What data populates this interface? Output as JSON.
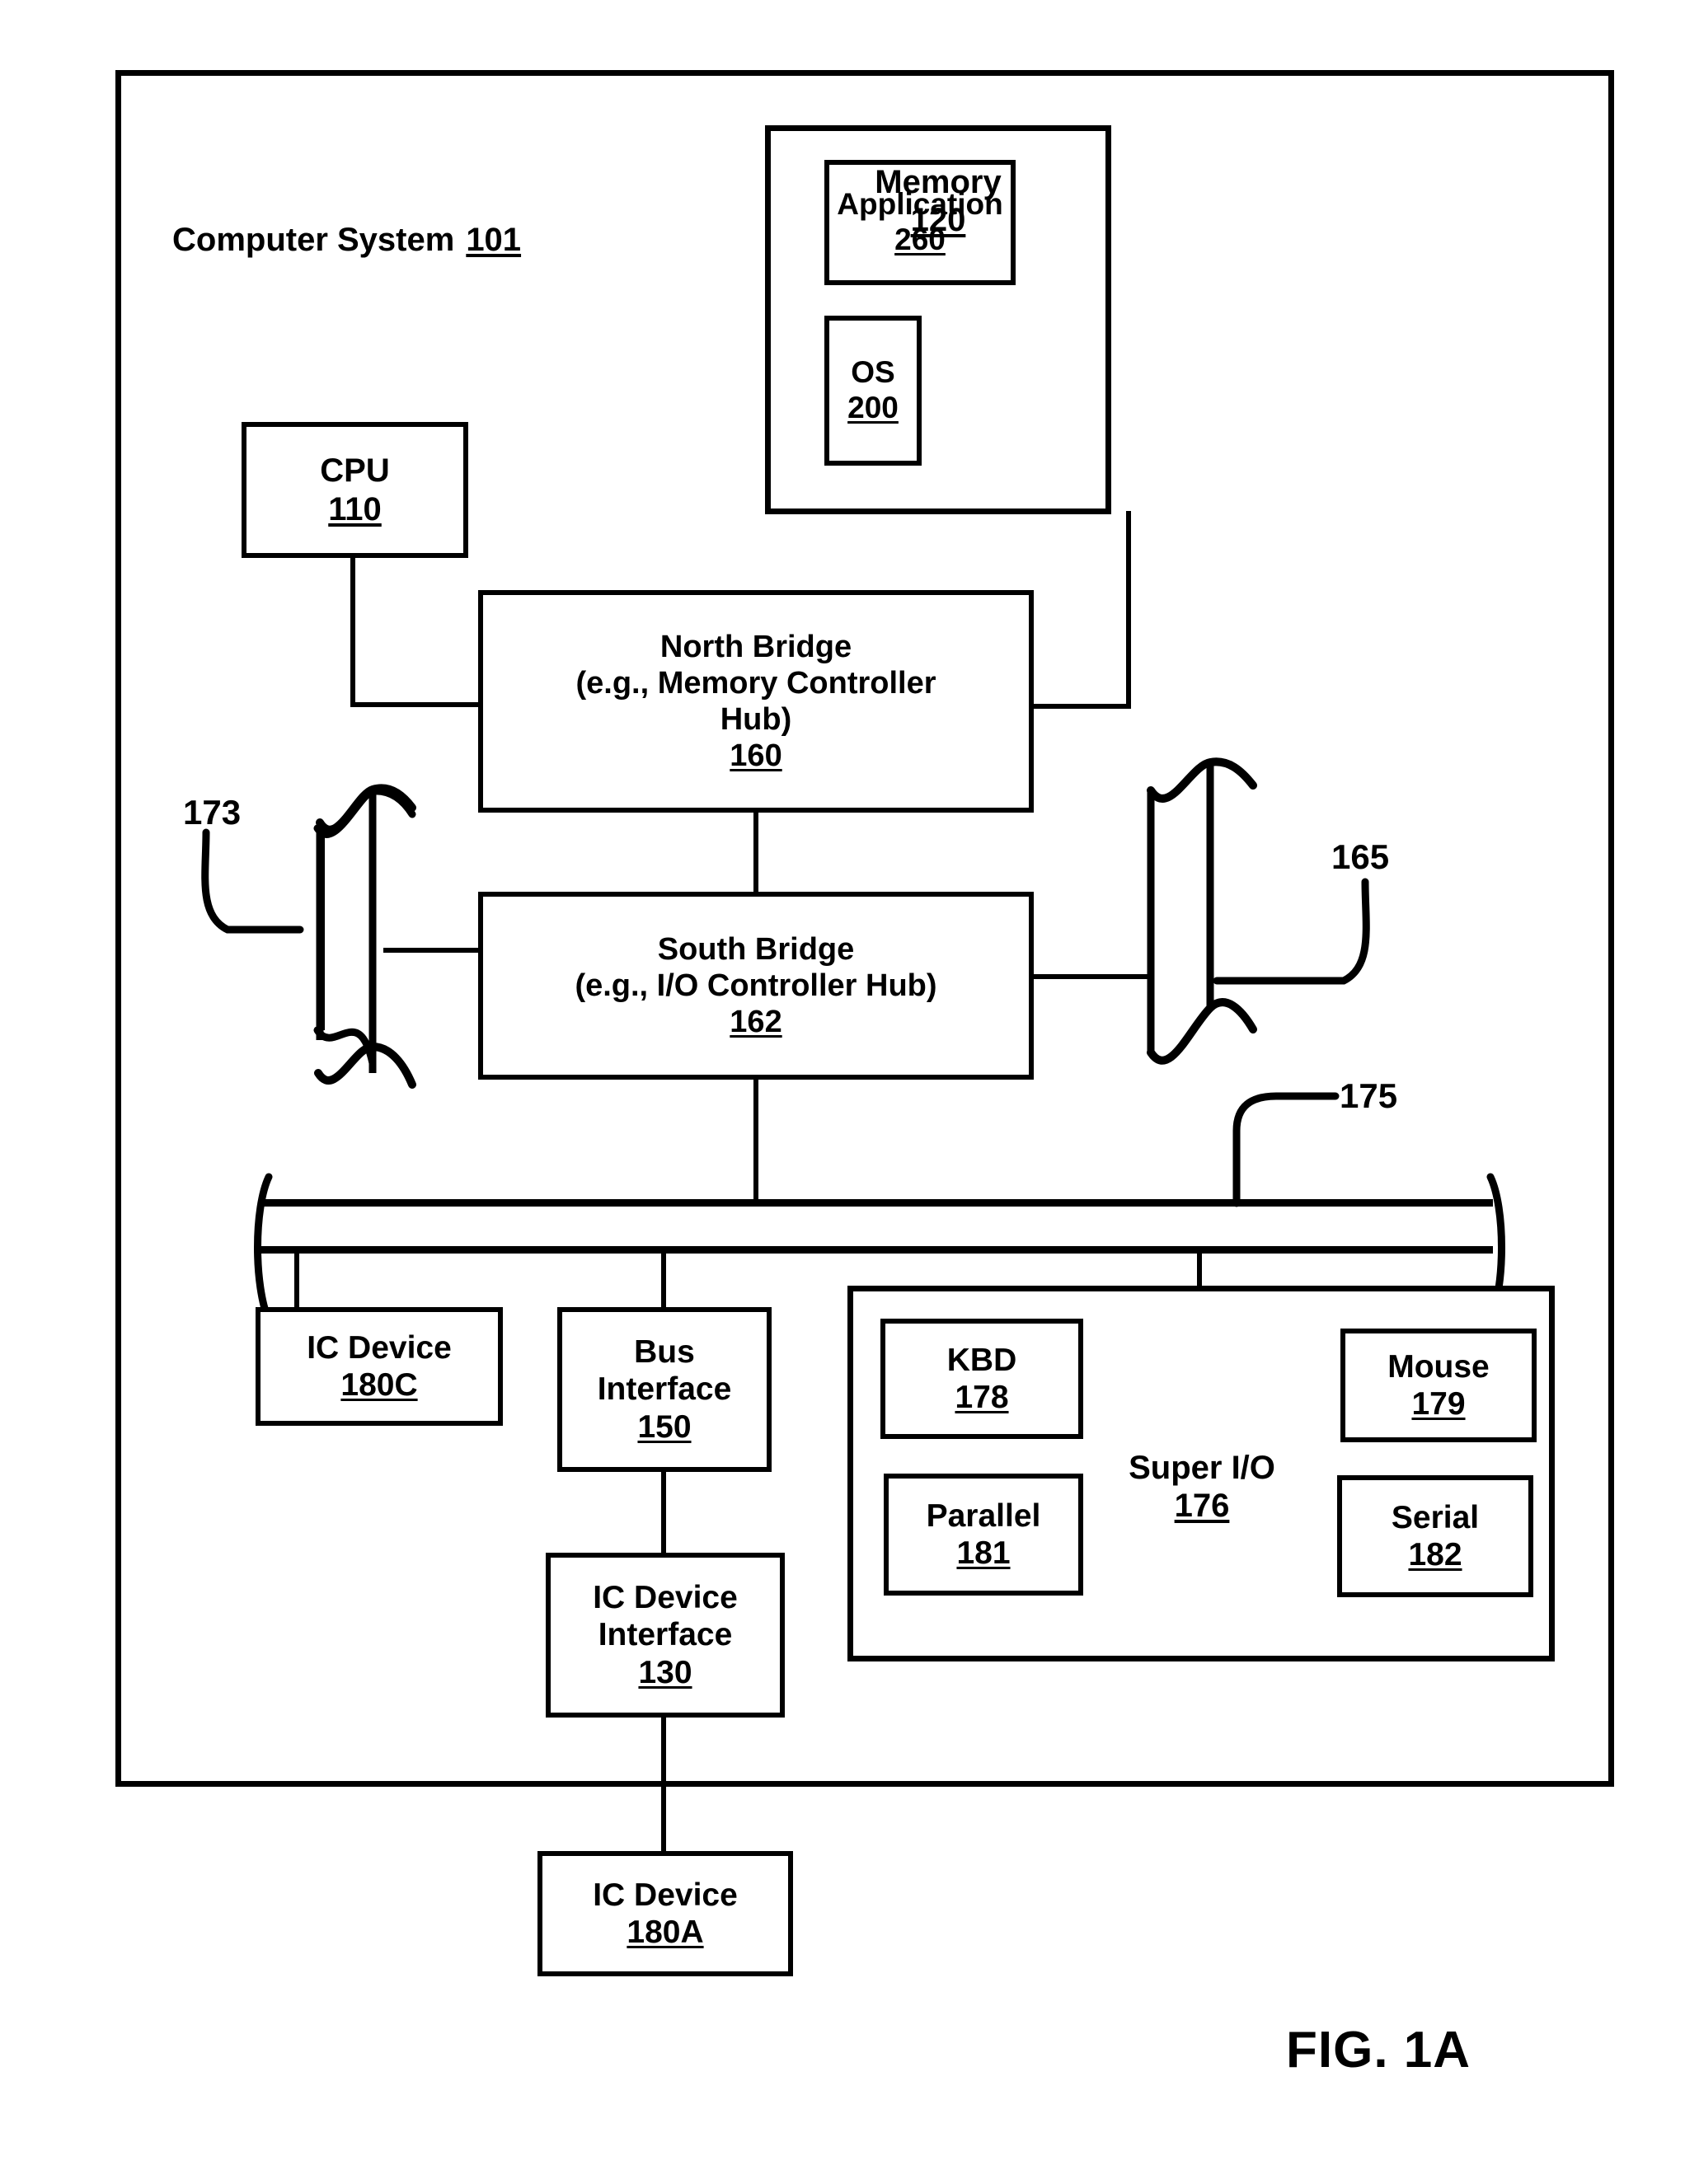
{
  "figure": {
    "caption": "FIG. 1A",
    "outer_label_title": "Computer System",
    "outer_label_number": "101"
  },
  "blocks": {
    "memory": {
      "title": "Memory",
      "number": "120"
    },
    "application": {
      "title": "Application",
      "number": "260"
    },
    "os": {
      "title": "OS",
      "number": "200"
    },
    "cpu": {
      "title": "CPU",
      "number": "110"
    },
    "north_bridge": {
      "title": "North Bridge\n(e.g., Memory Controller\nHub)",
      "number": "160"
    },
    "south_bridge": {
      "title": "South Bridge\n(e.g., I/O Controller Hub)",
      "number": "162"
    },
    "ic_device_180c": {
      "title": "IC Device",
      "number": "180C"
    },
    "bus_interface": {
      "title": "Bus\nInterface",
      "number": "150"
    },
    "ic_device_interface": {
      "title": "IC Device\nInterface",
      "number": "130"
    },
    "ic_device_180a": {
      "title": "IC Device",
      "number": "180A"
    },
    "super_io": {
      "title": "Super I/O",
      "number": "176"
    },
    "kbd": {
      "title": "KBD",
      "number": "178"
    },
    "mouse": {
      "title": "Mouse",
      "number": "179"
    },
    "parallel": {
      "title": "Parallel",
      "number": "181"
    },
    "serial": {
      "title": "Serial",
      "number": "182"
    }
  },
  "reference_numerals": {
    "bus_173": "173",
    "bus_165": "165",
    "bus_175": "175"
  },
  "colors": {
    "ink": "#000000",
    "paper": "#ffffff"
  }
}
